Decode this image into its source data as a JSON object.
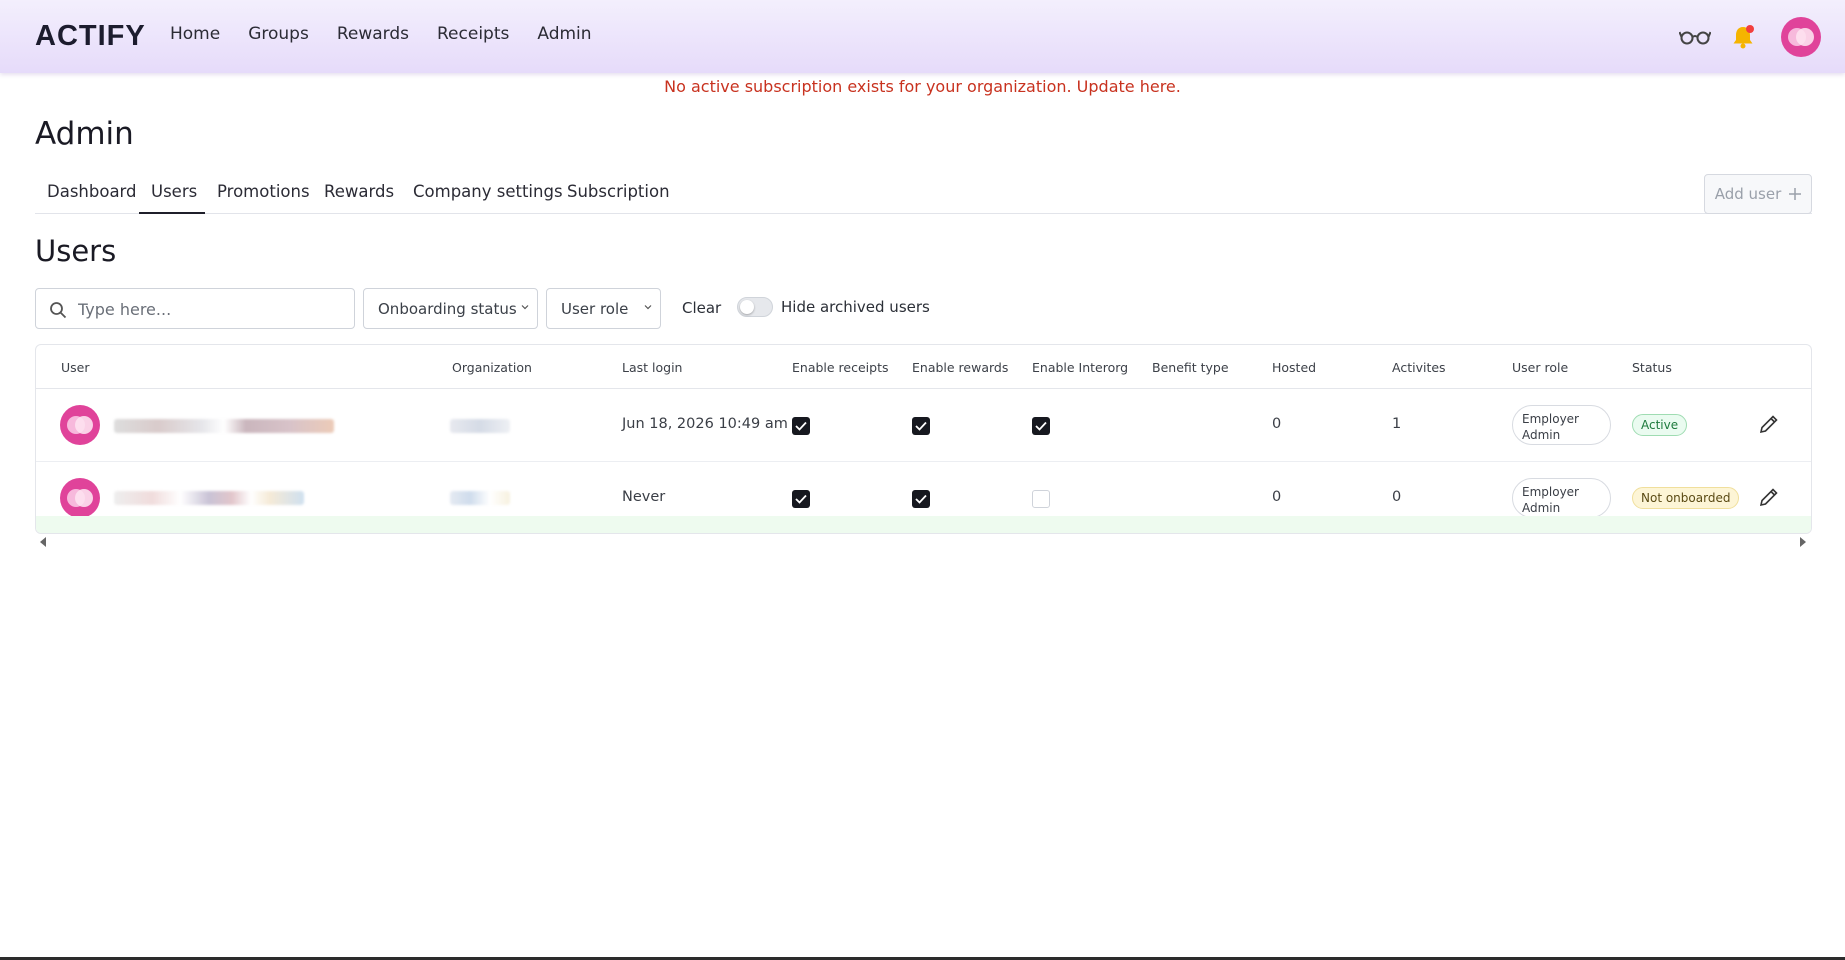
{
  "brand": {
    "logo": "ACTIFY"
  },
  "nav": {
    "items": [
      "Home",
      "Groups",
      "Rewards",
      "Receipts",
      "Admin"
    ]
  },
  "icons": {
    "glasses": "glasses-icon",
    "bell": "bell-icon",
    "search": "search-icon",
    "edit": "pencil-icon",
    "plus": "plus-icon",
    "check": "check-icon"
  },
  "colors": {
    "accent": "#e0439a",
    "banner": "#c8321f",
    "header_bg": "#e6dbfa"
  },
  "banner": {
    "text": "No active subscription exists for your organization. Update here."
  },
  "page": {
    "title": "Admin"
  },
  "tabs": [
    "Dashboard",
    "Users",
    "Promotions",
    "Rewards",
    "Company settings",
    "Subscription"
  ],
  "active_tab": "Users",
  "actions": {
    "add_user": "Add user"
  },
  "section": {
    "title": "Users"
  },
  "filters": {
    "search_placeholder": "Type here...",
    "onboarding_status": "Onboarding status",
    "user_role": "User role",
    "clear": "Clear",
    "hide_archived": "Hide archived users",
    "hide_archived_on": false
  },
  "table": {
    "headers": [
      "User",
      "Organization",
      "Last login",
      "Enable receipts",
      "Enable rewards",
      "Enable Interorg",
      "Benefit type",
      "Hosted",
      "Activites",
      "User role",
      "Status"
    ],
    "rows": [
      {
        "last_login": "Jun 18, 2026 10:49 am",
        "enable_receipts": true,
        "enable_rewards": true,
        "enable_interorg": true,
        "benefit_type": "",
        "hosted": "0",
        "activities": "1",
        "role_line1": "Employer",
        "role_line2": "Admin",
        "status": "Active"
      },
      {
        "last_login": "Never",
        "enable_receipts": true,
        "enable_rewards": true,
        "enable_interorg": false,
        "benefit_type": "",
        "hosted": "0",
        "activities": "0",
        "role_line1": "Employer",
        "role_line2": "Admin",
        "status": "Not onboarded"
      }
    ]
  }
}
